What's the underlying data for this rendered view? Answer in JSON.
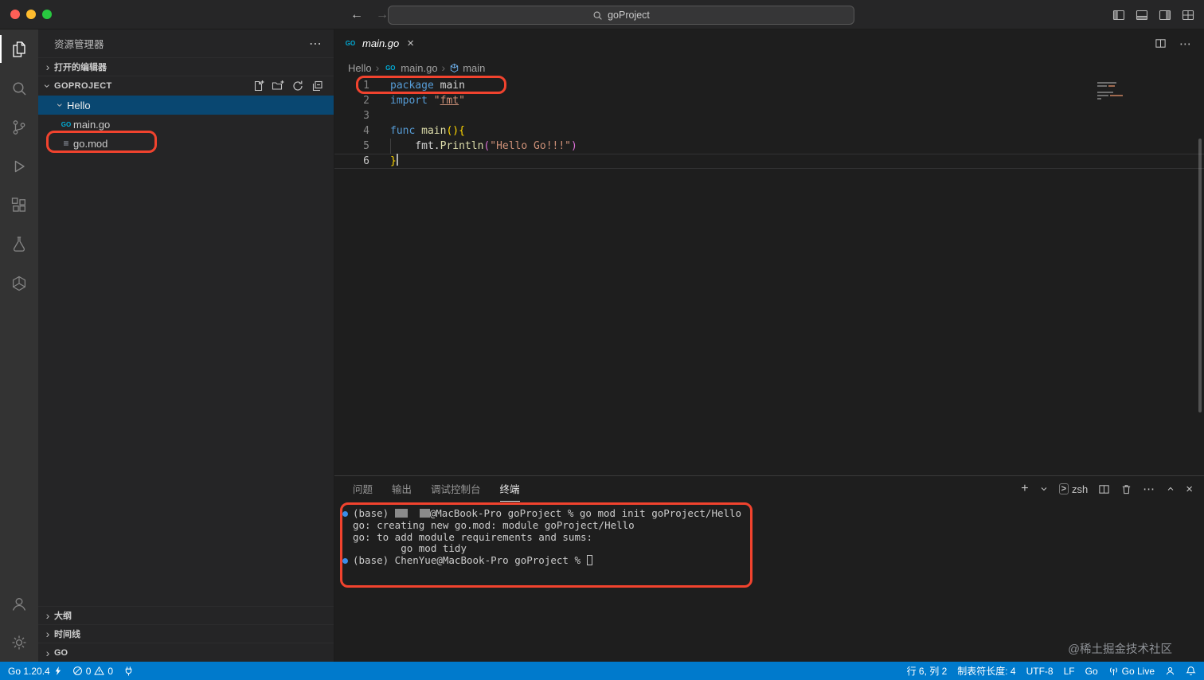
{
  "titlebar": {
    "search_value": "goProject"
  },
  "sidebar": {
    "title": "资源管理器",
    "open_editors_label": "打开的编辑器",
    "project_label": "GOPROJECT",
    "tree": {
      "folder": "Hello",
      "files": [
        "main.go",
        "go.mod"
      ]
    },
    "bottom_sections": [
      "大纲",
      "时间线",
      "GO"
    ]
  },
  "editor": {
    "tab_label": "main.go",
    "breadcrumbs": [
      "Hello",
      "main.go",
      "main"
    ],
    "code": {
      "lines": [
        {
          "n": 1,
          "tokens": [
            {
              "t": "package",
              "c": "keyword"
            },
            {
              "t": " main",
              "c": "fg"
            }
          ]
        },
        {
          "n": 2,
          "tokens": [
            {
              "t": "import",
              "c": "keyword"
            },
            {
              "t": " ",
              "c": "fg"
            },
            {
              "t": "\"",
              "c": "string"
            },
            {
              "t": "fmt",
              "c": "string",
              "u": true
            },
            {
              "t": "\"",
              "c": "string"
            }
          ]
        },
        {
          "n": 3,
          "tokens": []
        },
        {
          "n": 4,
          "tokens": [
            {
              "t": "func",
              "c": "keyword"
            },
            {
              "t": " ",
              "c": "fg"
            },
            {
              "t": "main",
              "c": "function"
            },
            {
              "t": "()",
              "c": "bracket1"
            },
            {
              "t": "{",
              "c": "bracket1"
            }
          ]
        },
        {
          "n": 5,
          "tokens": [
            {
              "t": "    fmt",
              "c": "fg"
            },
            {
              "t": ".",
              "c": "fg"
            },
            {
              "t": "Println",
              "c": "function"
            },
            {
              "t": "(",
              "c": "bracket2"
            },
            {
              "t": "\"Hello Go!!!\"",
              "c": "string"
            },
            {
              "t": ")",
              "c": "bracket2"
            }
          ]
        },
        {
          "n": 6,
          "tokens": [
            {
              "t": "}",
              "c": "bracket1"
            }
          ],
          "current": true
        }
      ]
    }
  },
  "panel": {
    "tabs": [
      "问题",
      "输出",
      "调试控制台",
      "终端"
    ],
    "active_tab": "终端",
    "shell_label": "zsh",
    "terminal_lines": [
      {
        "dot": true,
        "segments": [
          {
            "t": "(base) "
          },
          {
            "block": 16
          },
          {
            "t": "  "
          },
          {
            "block": 13
          },
          {
            "t": "@MacBook-Pro goProject % go mod init goProject/Hello"
          }
        ]
      },
      {
        "segments": [
          {
            "t": "go: creating new go.mod: module goProject/Hello"
          }
        ]
      },
      {
        "segments": [
          {
            "t": "go: to add module requirements and sums:"
          }
        ]
      },
      {
        "segments": [
          {
            "t": "        go mod tidy"
          }
        ]
      },
      {
        "dot": true,
        "segments": [
          {
            "t": "(base) ChenYue@MacBook-Pro goProject % "
          },
          {
            "cursor": true
          }
        ]
      }
    ]
  },
  "statusbar": {
    "go_version": "Go 1.20.4",
    "error_count": "0",
    "warning_count": "0",
    "line_col": "行 6, 列 2",
    "tab_size": "制表符长度: 4",
    "encoding": "UTF-8",
    "eol": "LF",
    "language": "Go",
    "go_live": "Go Live"
  },
  "watermark": "@稀土掘金技术社区",
  "colors": {
    "statusbar": "#007acc",
    "annotation": "#f1432e",
    "selection_bg": "#094771",
    "syntax": {
      "keyword": "#569cd6",
      "fg": "#d4d4d4",
      "string": "#ce9178",
      "function": "#dcdcaa",
      "bracket1": "#ffd700",
      "bracket2": "#da70d6"
    }
  }
}
